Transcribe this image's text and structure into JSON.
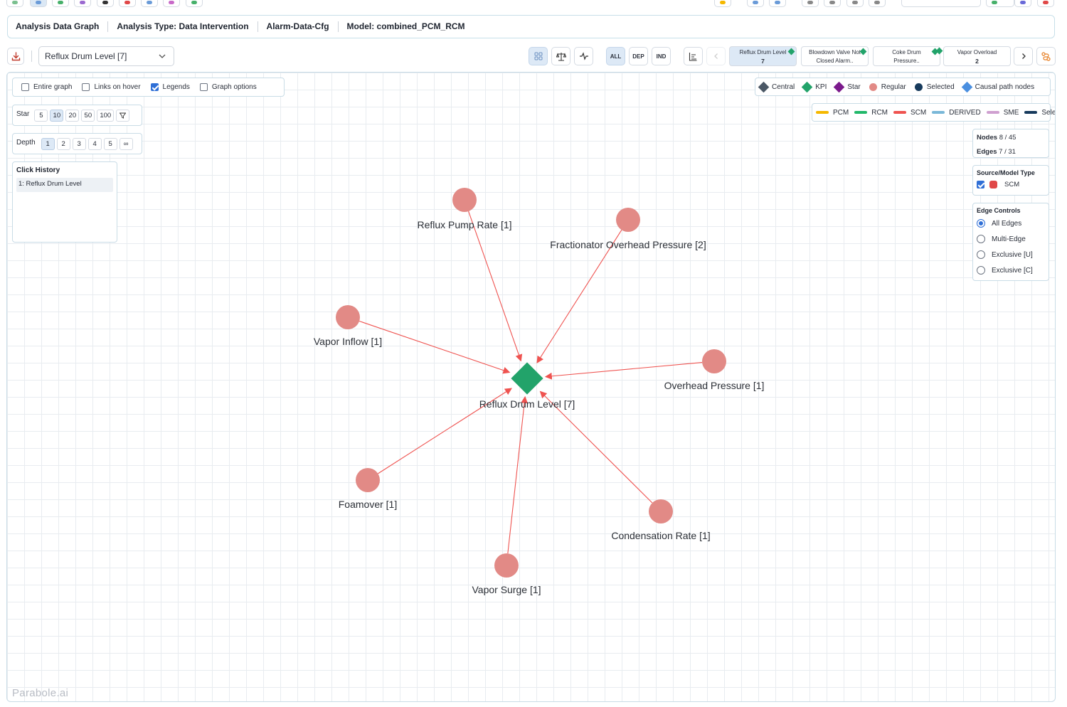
{
  "breadcrumb": {
    "title": "Analysis Data Graph",
    "analysis_type": "Analysis Type: Data Intervention",
    "config": "Alarm-Data-Cfg",
    "model": "Model: combined_PCM_RCM"
  },
  "toolbar": {
    "selected_node": "Reflux Drum Level [7]",
    "filter_all": "ALL",
    "filter_dep": "DEP",
    "filter_ind": "IND",
    "kpi_tabs": [
      {
        "label": "Reflux Drum Level",
        "value": "7"
      },
      {
        "label": "Blowdown Valve Not Closed Alarm..",
        "value": ""
      },
      {
        "label": "Coke Drum Pressure..",
        "value": ""
      },
      {
        "label": "Vapor Overload",
        "value": "2"
      }
    ]
  },
  "options": {
    "entire_graph": "Entire graph",
    "links_on_hover": "Links on hover",
    "legends": "Legends",
    "graph_options": "Graph options"
  },
  "star": {
    "label": "Star",
    "values": [
      "5",
      "10",
      "20",
      "50",
      "100"
    ],
    "selected": "10"
  },
  "depth": {
    "label": "Depth",
    "values": [
      "1",
      "2",
      "3",
      "4",
      "5",
      "∞"
    ],
    "selected": "1"
  },
  "click_history": {
    "title": "Click History",
    "items": [
      "1: Reflux Drum Level"
    ]
  },
  "legend_nodes": [
    {
      "label": "Central",
      "shape": "diamond",
      "color": "#4b5866"
    },
    {
      "label": "KPI",
      "shape": "diamond",
      "color": "#22a36a"
    },
    {
      "label": "Star",
      "shape": "diamond",
      "color": "#7b1a8c"
    },
    {
      "label": "Regular",
      "shape": "circle",
      "color": "#e28a86"
    },
    {
      "label": "Selected",
      "shape": "circle",
      "color": "#173a5c"
    },
    {
      "label": "Causal path nodes",
      "shape": "diamond",
      "color": "#4a8fe0"
    }
  ],
  "legend_edges": [
    {
      "label": "PCM",
      "color": "#f5b800"
    },
    {
      "label": "RCM",
      "color": "#22b86a"
    },
    {
      "label": "SCM",
      "color": "#ef5350"
    },
    {
      "label": "DERIVED",
      "color": "#7ab8d8"
    },
    {
      "label": "SME",
      "color": "#cfa0d0"
    },
    {
      "label": "Selected",
      "color": "#173a5c"
    }
  ],
  "stats": {
    "nodes_label": "Nodes",
    "nodes_value": "8 / 45",
    "edges_label": "Edges",
    "edges_value": "7 / 31"
  },
  "source_model": {
    "title": "Source/Model Type",
    "items": [
      {
        "label": "SCM",
        "color": "#e04848"
      }
    ]
  },
  "edge_controls": {
    "title": "Edge Controls",
    "options": [
      "All Edges",
      "Multi-Edge",
      "Exclusive [U]",
      "Exclusive [C]"
    ],
    "selected": "All Edges"
  },
  "graph": {
    "central": {
      "label": "Reflux Drum Level [7]",
      "color": "#22a36a"
    },
    "edge_color": "#ef5350",
    "node_color": "#e28a86",
    "nodes": [
      {
        "label": "Reflux Pump Rate [1]"
      },
      {
        "label": "Fractionator Overhead Pressure [2]"
      },
      {
        "label": "Vapor Inflow [1]"
      },
      {
        "label": "Overhead Pressure [1]"
      },
      {
        "label": "Foamover [1]"
      },
      {
        "label": "Condensation Rate [1]"
      },
      {
        "label": "Vapor Surge [1]"
      }
    ]
  },
  "brand": "Parabole.ai"
}
